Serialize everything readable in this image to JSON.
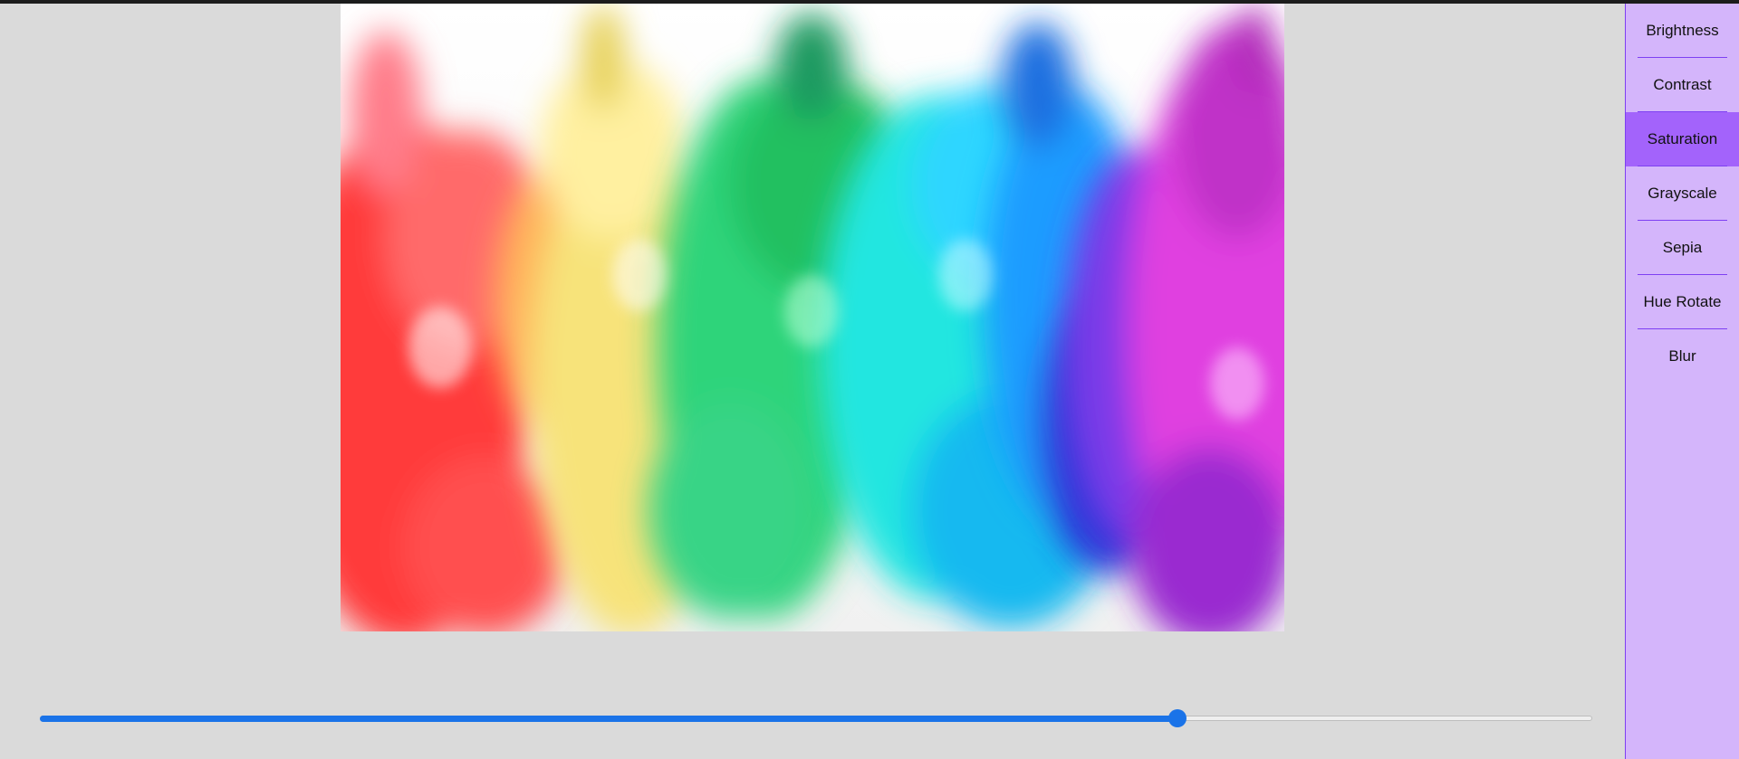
{
  "filters": {
    "items": [
      {
        "label": "Brightness"
      },
      {
        "label": "Contrast"
      },
      {
        "label": "Saturation"
      },
      {
        "label": "Grayscale"
      },
      {
        "label": "Sepia"
      },
      {
        "label": "Hue Rotate"
      },
      {
        "label": "Blur"
      }
    ],
    "active": "Saturation"
  },
  "slider": {
    "value_fraction": 0.733
  },
  "colors": {
    "sidebar_bg": "#d4b5fb",
    "active_item_bg": "#a363fb",
    "divider": "#7e3ff2",
    "slider_accent": "#1a73e8",
    "workspace_bg": "#dadada"
  },
  "image": {
    "icon": "colorful-ink-smoke-photo"
  }
}
